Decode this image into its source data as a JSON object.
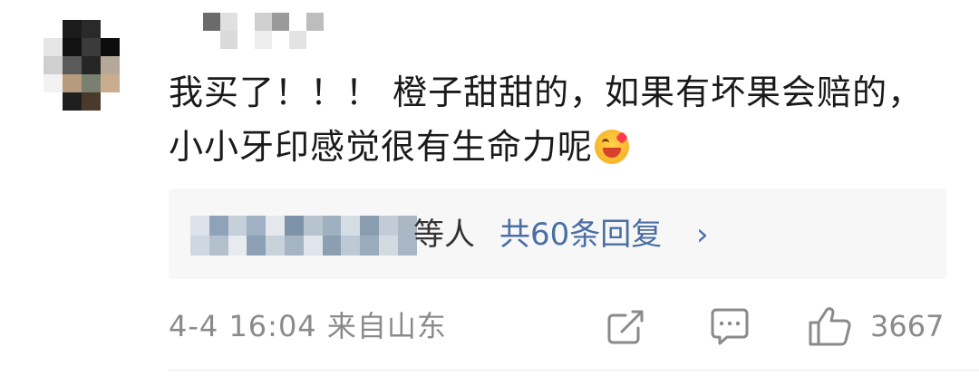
{
  "comment": {
    "text": "我买了！！！ 橙子甜甜的，如果有坏果会赔的，小小牙印感觉很有生命力呢"
  },
  "replies": {
    "others_label": "等人",
    "count_label": "共60条回复",
    "chevron": "›"
  },
  "meta": {
    "timestamp": "4-4 16:04",
    "source": "来自山东"
  },
  "actions": {
    "like_count": "3667",
    "icons": [
      "share-icon",
      "comment-icon",
      "like-icon"
    ]
  },
  "colors": {
    "link": "#4a6fa5",
    "meta_gray": "#8a8a8a",
    "reply_bg": "#f7f7f7"
  }
}
